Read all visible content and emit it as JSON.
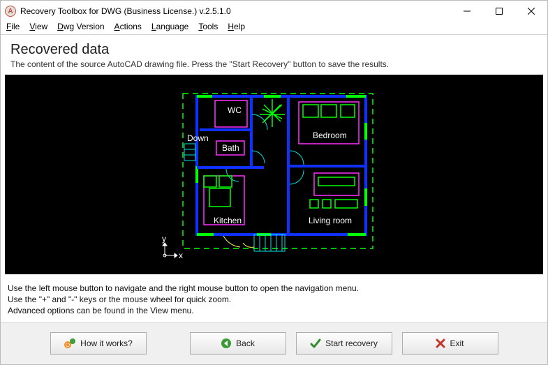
{
  "titlebar": {
    "app_icon": "A",
    "title": "Recovery Toolbox for DWG (Business License.) v.2.5.1.0"
  },
  "menu": {
    "file": "File",
    "view": "View",
    "dwg": "Dwg Version",
    "actions": "Actions",
    "language": "Language",
    "tools": "Tools",
    "help": "Help"
  },
  "header": {
    "title": "Recovered data",
    "subtitle": "The content of the source AutoCAD drawing file. Press the \"Start Recovery\" button to save the results."
  },
  "drawing": {
    "rooms": {
      "wc": "WC",
      "bath": "Bath",
      "bedroom": "Bedroom",
      "living": "Living room",
      "kitchen": "Kitchen"
    },
    "labels": {
      "down": "Down"
    },
    "axes": {
      "x": "x",
      "y": "y"
    },
    "colors": {
      "wall": "#1030ff",
      "accent": "#00ff00",
      "cyan": "#00e0e0",
      "magenta": "#ff30ff",
      "yellow": "#ffff40",
      "white": "#ffffff"
    }
  },
  "help_lines": [
    "Use the left mouse button to navigate and the right mouse button to open the navigation menu.",
    "Use the \"+\" and \"-\" keys or the mouse wheel for quick zoom.",
    "Advanced options can be found in the View menu."
  ],
  "buttons": {
    "how": "How it works?",
    "back": "Back",
    "start": "Start recovery",
    "exit": "Exit"
  }
}
